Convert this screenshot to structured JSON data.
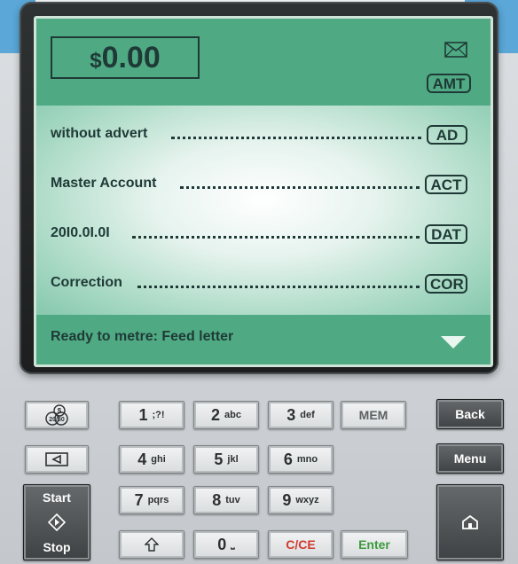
{
  "display": {
    "currency": "$",
    "amount": "0.00",
    "amount_tag": "AMT",
    "rows": [
      {
        "label": "without advert",
        "tag": "AD"
      },
      {
        "label": "Master Account",
        "tag": "ACT"
      },
      {
        "label": "20I0.0I.0I",
        "tag": "DAT"
      },
      {
        "label": "Correction",
        "tag": "COR"
      }
    ],
    "status": "Ready to metre: Feed letter"
  },
  "keypad": {
    "digits": [
      {
        "num": "1",
        "letters": ";?!"
      },
      {
        "num": "2",
        "letters": "abc"
      },
      {
        "num": "3",
        "letters": "def"
      },
      {
        "num": "4",
        "letters": "ghi"
      },
      {
        "num": "5",
        "letters": "jkl"
      },
      {
        "num": "6",
        "letters": "mno"
      },
      {
        "num": "7",
        "letters": "pqrs"
      },
      {
        "num": "8",
        "letters": "tuv"
      },
      {
        "num": "9",
        "letters": "wxyz"
      },
      {
        "num": "0",
        "letters": "⎵"
      }
    ],
    "mem": "MEM",
    "clear": "C/CE",
    "enter": "Enter",
    "back": "Back",
    "menu": "Menu",
    "start": "Start",
    "stop": "Stop",
    "rates_icon_text_top": "$",
    "rates_icon_text_bottom": "20/50"
  },
  "icons": [
    "envelope-icon",
    "down-arrow-icon",
    "rates-icon",
    "left-arrow-icon",
    "diamond-icon",
    "shift-icon",
    "home-icon"
  ],
  "colors": {
    "screen": "#4faa84",
    "text": "#1f3a36",
    "clear": "#d33a2e",
    "enter": "#3c9b3c"
  }
}
